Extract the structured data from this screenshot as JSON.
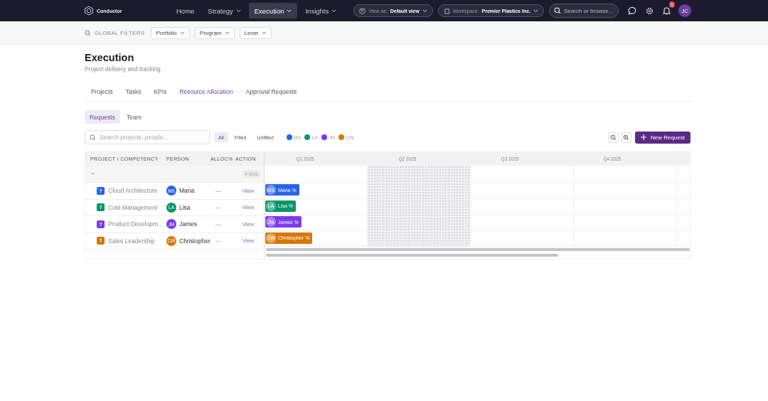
{
  "nav": {
    "brand": "Conductor",
    "menu": [
      {
        "label": "Home",
        "selected": false,
        "dropdown": false
      },
      {
        "label": "Strategy",
        "selected": false,
        "dropdown": true
      },
      {
        "label": "Execution",
        "selected": true,
        "dropdown": true
      },
      {
        "label": "Insights",
        "selected": false,
        "dropdown": true
      }
    ],
    "view_as": {
      "label": "View as:",
      "value": "Default view"
    },
    "workspace": {
      "label": "Workspace:",
      "value": "Premier Plastics Inc."
    },
    "search": {
      "placeholder": "Search or browse..."
    },
    "notifications": "5",
    "avatar": "JC"
  },
  "filters": {
    "label": "GLOBAL FILTERS",
    "items": [
      "Portfolio",
      "Program",
      "Lever"
    ]
  },
  "page": {
    "title": "Execution",
    "subtitle": "Project delivery and tracking"
  },
  "tabs": [
    {
      "label": "Projects",
      "selected": false
    },
    {
      "label": "Tasks",
      "selected": false
    },
    {
      "label": "KPIs",
      "selected": false
    },
    {
      "label": "Resource Allocation",
      "selected": true
    },
    {
      "label": "Approval Requests",
      "selected": false
    }
  ],
  "subtabs": [
    {
      "label": "Requests",
      "selected": true
    },
    {
      "label": "Team",
      "selected": false
    }
  ],
  "search": {
    "placeholder": "Search projects, people..."
  },
  "status_filters": [
    {
      "label": "All",
      "selected": true
    },
    {
      "label": "Filled",
      "selected": false
    },
    {
      "label": "Unfilled",
      "selected": false
    }
  ],
  "people": [
    {
      "initials": "MS",
      "color": "#2563eb"
    },
    {
      "initials": "LA",
      "color": "#059669"
    },
    {
      "initials": "JM",
      "color": "#7c3aed"
    },
    {
      "initials": "CW",
      "color": "#d97706"
    }
  ],
  "new_request": "New Request",
  "table": {
    "columns": [
      "PROJECT / COMPETENCY",
      "PERSON",
      "ALLOC%",
      "ACTION"
    ],
    "quarters": [
      {
        "label": "Q1 2025",
        "shaded": false
      },
      {
        "label": "Q2 2025",
        "shaded": true
      },
      {
        "label": "Q3 2025",
        "shaded": false
      },
      {
        "label": "Q4 2025",
        "shaded": false
      }
    ],
    "group": {
      "slots": "4 slots"
    },
    "rows": [
      {
        "badge": "?",
        "project": "Cloud Architecture",
        "initials": "MS",
        "person": "Maria",
        "alloc": "—",
        "action": "View",
        "bar_initials": "MS",
        "bar": "Maria %",
        "color": "#2563eb"
      },
      {
        "badge": "?",
        "project": "Cost Management",
        "initials": "LA",
        "person": "Lisa",
        "alloc": "—",
        "action": "View",
        "bar_initials": "LA",
        "bar": "Lisa %",
        "color": "#059669"
      },
      {
        "badge": "?",
        "project": "Product Developm...",
        "initials": "JM",
        "person": "James",
        "alloc": "—",
        "action": "View",
        "bar_initials": "JM",
        "bar": "James %",
        "color": "#7c3aed"
      },
      {
        "badge": "?",
        "project": "Sales Leadership",
        "initials": "CW",
        "person": "Christopher",
        "alloc": "—",
        "action": "View",
        "bar_initials": "CW",
        "bar": "Christopher %",
        "color": "#d97706"
      }
    ]
  }
}
